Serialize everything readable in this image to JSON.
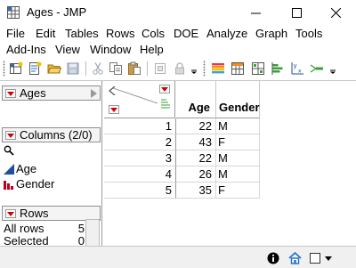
{
  "window": {
    "title": "Ages - JMP",
    "minimize_glyph": "–",
    "maximize_glyph": "☐",
    "close_glyph": "✕"
  },
  "menu": {
    "row1": [
      "File",
      "Edit",
      "Tables",
      "Rows",
      "Cols",
      "DOE",
      "Analyze",
      "Graph",
      "Tools"
    ],
    "row2": [
      "Add-Ins",
      "View",
      "Window",
      "Help"
    ]
  },
  "toolbar": {
    "icons": [
      "new-data-table-icon",
      "new-script-icon",
      "open-icon",
      "save-icon",
      "cut-icon",
      "copy-icon",
      "paste-icon",
      "copy-with-labels-icon",
      "lock-icon",
      "toolbar-overflow-icon",
      "data-table-icon",
      "tabulate-icon",
      "graph-builder-icon",
      "distribution-icon",
      "fit-y-by-x-icon",
      "fit-model-icon",
      "toolbar-overflow-icon"
    ]
  },
  "left_panel": {
    "table_panel": {
      "title": "Ages"
    },
    "columns_panel": {
      "title": "Columns (2/0)",
      "search_placeholder": "",
      "search_icon": "search-icon",
      "columns": [
        {
          "name": "Age",
          "icon": "continuous-icon",
          "icon_color": "#1f4e9c"
        },
        {
          "name": "Gender",
          "icon": "nominal-icon",
          "icon_color": "#c0001a"
        }
      ]
    },
    "rows_panel": {
      "title": "Rows",
      "stats": [
        {
          "label": "All rows",
          "value": "5"
        },
        {
          "label": "Selected",
          "value": "0"
        }
      ]
    }
  },
  "grid": {
    "columns": [
      "Age",
      "Gender"
    ],
    "rows": [
      {
        "n": "1",
        "age": "22",
        "gender": "M"
      },
      {
        "n": "2",
        "age": "43",
        "gender": "F"
      },
      {
        "n": "3",
        "age": "22",
        "gender": "M"
      },
      {
        "n": "4",
        "age": "26",
        "m": "",
        "gender": "M"
      },
      {
        "n": "5",
        "age": "35",
        "gender": "F"
      }
    ]
  },
  "status_bar": {
    "icons": [
      "info-icon",
      "home-icon",
      "window-select-icon"
    ]
  },
  "colors": {
    "red_triangle": "#d40000",
    "continuous_blue": "#1f4e9c",
    "nominal_red": "#c0001a",
    "panel_header_bg": "#f4f4f4"
  }
}
